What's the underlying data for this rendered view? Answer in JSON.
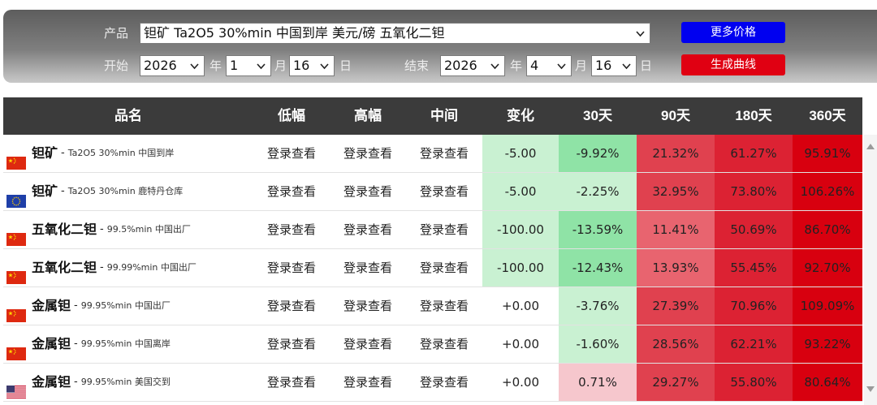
{
  "filters": {
    "product_label": "产品",
    "product_value": "钽矿 Ta2O5 30%min 中国到岸 美元/磅 五氧化二钽",
    "start_label": "开始",
    "start_year": "2026",
    "start_month": "1",
    "start_day": "16",
    "end_label": "结束",
    "end_year": "2026",
    "end_month": "4",
    "end_day": "16",
    "unit_year": "年",
    "unit_month": "月",
    "unit_day": "日",
    "more_prices_label": "更多价格",
    "generate_chart_label": "生成曲线"
  },
  "table": {
    "headers": [
      "品名",
      "低幅",
      "高幅",
      "中间",
      "变化",
      "30天",
      "90天",
      "180天",
      "360天"
    ],
    "rows": [
      {
        "flag": "china-flag",
        "name": "钽矿",
        "spec": "Ta2O5 30%min 中国到岸",
        "low": "登录查看",
        "high": "登录查看",
        "mid": "登录查看",
        "change": "-5.00",
        "d30": "-9.92%",
        "d90": "21.32%",
        "d180": "61.27%",
        "d360": "95.91%"
      },
      {
        "flag": "eu-flag",
        "name": "钽矿",
        "spec": "Ta2O5 30%min 鹿特丹仓库",
        "low": "登录查看",
        "high": "登录查看",
        "mid": "登录查看",
        "change": "-5.00",
        "d30": "-2.25%",
        "d90": "32.95%",
        "d180": "73.80%",
        "d360": "106.26%"
      },
      {
        "flag": "china-flag",
        "name": "五氧化二钽",
        "spec": "99.5%min 中国出厂",
        "low": "登录查看",
        "high": "登录查看",
        "mid": "登录查看",
        "change": "-100.00",
        "d30": "-13.59%",
        "d90": "11.41%",
        "d180": "50.69%",
        "d360": "86.70%"
      },
      {
        "flag": "china-flag",
        "name": "五氧化二钽",
        "spec": "99.99%min 中国出厂",
        "low": "登录查看",
        "high": "登录查看",
        "mid": "登录查看",
        "change": "-100.00",
        "d30": "-12.43%",
        "d90": "13.93%",
        "d180": "55.45%",
        "d360": "92.70%"
      },
      {
        "flag": "china-flag",
        "name": "金属钽",
        "spec": "99.95%min 中国出厂",
        "low": "登录查看",
        "high": "登录查看",
        "mid": "登录查看",
        "change": "+0.00",
        "d30": "-3.76%",
        "d90": "27.39%",
        "d180": "70.96%",
        "d360": "109.09%"
      },
      {
        "flag": "china-flag",
        "name": "金属钽",
        "spec": "99.95%min 中国离岸",
        "low": "登录查看",
        "high": "登录查看",
        "mid": "登录查看",
        "change": "+0.00",
        "d30": "-1.60%",
        "d90": "28.56%",
        "d180": "62.21%",
        "d360": "93.22%"
      },
      {
        "flag": "usa-flag",
        "name": "金属钽",
        "spec": "99.95%min 美国交到",
        "low": "登录查看",
        "high": "登录查看",
        "mid": "登录查看",
        "change": "+0.00",
        "d30": "0.71%",
        "d90": "29.27%",
        "d180": "55.80%",
        "d360": "80.64%"
      }
    ]
  },
  "colors": {
    "header_bg": "#3b3b3b",
    "button_blue": "#0000f0",
    "button_red": "#e00012"
  }
}
